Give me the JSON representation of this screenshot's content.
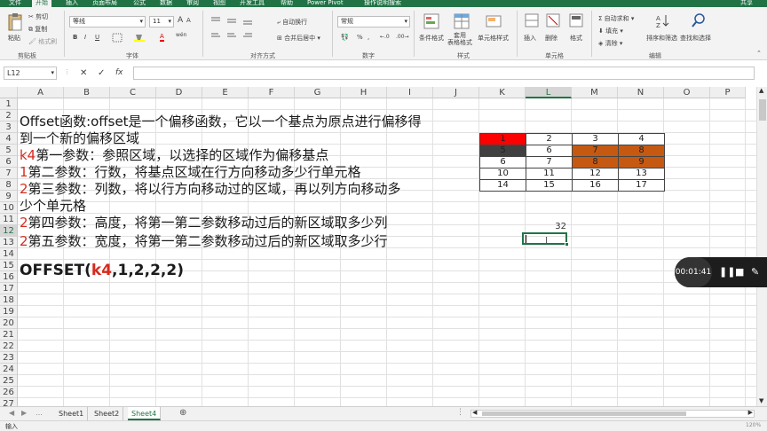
{
  "ribbon_tabs": [
    "文件",
    "开始",
    "插入",
    "页面布局",
    "公式",
    "数据",
    "审阅",
    "视图",
    "开发工具",
    "帮助",
    "Power Pivot",
    "操作说明搜索",
    "共享"
  ],
  "active_tab": "开始",
  "clipboard": {
    "paste": "粘贴",
    "cut": "剪切",
    "copy": "复制",
    "format_painter": "格式刷",
    "group": "剪贴板"
  },
  "font": {
    "name": "等线",
    "size": "11",
    "bold": "B",
    "italic": "I",
    "underline": "U",
    "grow": "A",
    "shrink": "A",
    "color_a": "A",
    "wen": "wén",
    "group": "字体"
  },
  "alignment": {
    "wrap": "自动换行",
    "merge": "合并后居中",
    "group": "对齐方式"
  },
  "number": {
    "format": "常规",
    "percent": "%",
    "comma": ",",
    "group": "数字"
  },
  "styles": {
    "conditional": "条件格式",
    "table": "套用\n表格格式",
    "cell_styles": "单元格样式",
    "group": "样式"
  },
  "cells": {
    "insert": "插入",
    "delete": "删除",
    "format": "格式",
    "group": "单元格"
  },
  "editing": {
    "autosum": "自动求和",
    "fill": "填充",
    "clear": "清除",
    "sort": "排序和筛选",
    "find": "查找和选择",
    "group": "编辑"
  },
  "formula_bar": {
    "name_box": "L12",
    "cancel": "✕",
    "enter": "✓",
    "fx": "fx",
    "value": ""
  },
  "columns": [
    "A",
    "B",
    "C",
    "D",
    "E",
    "F",
    "G",
    "H",
    "I",
    "J",
    "K",
    "L",
    "M",
    "N",
    "O",
    "P"
  ],
  "rows": [
    "1",
    "2",
    "3",
    "4",
    "5",
    "6",
    "7",
    "8",
    "9",
    "10",
    "11",
    "12",
    "13",
    "14",
    "15",
    "16",
    "17",
    "18",
    "19",
    "20",
    "21",
    "22",
    "23",
    "24",
    "25",
    "26",
    "27"
  ],
  "text_lines": {
    "l1": "Offset函数:offset是一个偏移函数，它以一个基点为原点进行偏移得",
    "l2": "到一个新的偏移区域",
    "l3_pre": "k4",
    "l3": "第一参数：参照区域，以选择的区域作为偏移基点",
    "l4_pre": "1",
    "l4": "第二参数：行数，将基点区域在行方向移动多少行单元格",
    "l5_pre": "2",
    "l5": "第三参数：列数，将以行方向移动过的区域，再以列方向移动多",
    "l6": "少个单元格",
    "l7_pre": "2",
    "l7": "第四参数：高度，将第一第二参数移动过后的新区域取多少列",
    "l8_pre": "2",
    "l8": "第五参数：宽度，将第一第二参数移动过后的新区域取多少行",
    "f_pre": "OFFSET(",
    "f_ref": "k4",
    "f_post": ",1,2,2,2)"
  },
  "table": [
    [
      "1",
      "2",
      "3",
      "4"
    ],
    [
      "5",
      "6",
      "7",
      "8"
    ],
    [
      "6",
      "7",
      "8",
      "9"
    ],
    [
      "10",
      "11",
      "12",
      "13"
    ],
    [
      "14",
      "15",
      "16",
      "17"
    ]
  ],
  "table_colors": {
    "red": "#ff0000",
    "dark": "#404040",
    "orange": "#c65911"
  },
  "cell_l11": "32",
  "sheets": [
    "Sheet1",
    "Sheet2",
    "Sheet4"
  ],
  "active_sheet": "Sheet4",
  "status": {
    "mode": "输入",
    "zoom": "120%"
  },
  "player": {
    "time": "00:01:41"
  },
  "accent": "#217346"
}
